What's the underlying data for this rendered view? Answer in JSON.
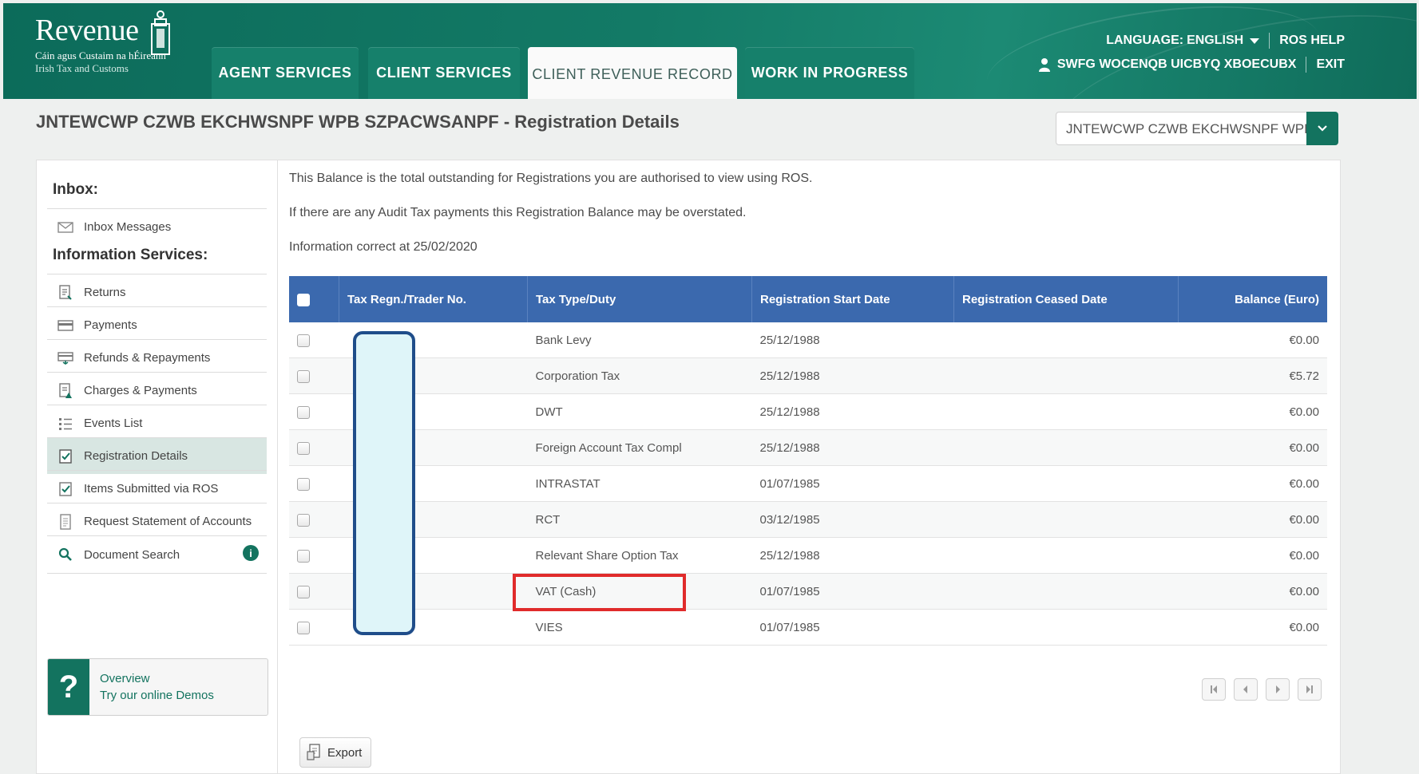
{
  "brand": {
    "name": "Revenue",
    "subtitle_irish": "Cáin agus Custaim na hÉireann",
    "subtitle_english": "Irish Tax and Customs"
  },
  "nav": {
    "tabs": [
      {
        "label": "AGENT SERVICES",
        "active": false
      },
      {
        "label": "CLIENT SERVICES",
        "active": false
      },
      {
        "label": "CLIENT REVENUE RECORD",
        "active": true
      },
      {
        "label": "WORK IN PROGRESS",
        "active": false
      }
    ]
  },
  "topbar": {
    "language_label": "LANGUAGE:",
    "language_value": "ENGLISH",
    "help": "ROS HELP",
    "user": "SWFG WOCENQB UICBYQ XBOECUBX",
    "exit": "EXIT"
  },
  "page": {
    "title": "JNTEWCWP CZWB EKCHWSNPF WPB SZPACWSANPF - Registration Details",
    "client_select": "JNTEWCWP CZWB EKCHWSNPF WPB"
  },
  "sidebar": {
    "inbox_heading": "Inbox:",
    "inbox_items": [
      {
        "label": "Inbox Messages",
        "icon": "envelope-icon"
      }
    ],
    "info_heading": "Information Services:",
    "items": [
      {
        "label": "Returns",
        "icon": "returns-icon",
        "active": false
      },
      {
        "label": "Payments",
        "icon": "card-icon",
        "active": false
      },
      {
        "label": "Refunds & Repayments",
        "icon": "refund-icon",
        "active": false
      },
      {
        "label": "Charges & Payments",
        "icon": "charges-icon",
        "active": false
      },
      {
        "label": "Events List",
        "icon": "list-icon",
        "active": false
      },
      {
        "label": "Registration Details",
        "icon": "checkbox-doc-icon",
        "active": true
      },
      {
        "label": "Items Submitted via ROS",
        "icon": "checkbox-doc-icon",
        "active": false
      },
      {
        "label": "Request Statement of Accounts",
        "icon": "document-icon",
        "active": false
      },
      {
        "label": "Document Search",
        "icon": "search-icon",
        "active": false
      }
    ],
    "demos": {
      "title": "Overview",
      "subtitle": "Try our online Demos"
    }
  },
  "notes": {
    "line1": "This Balance is the total outstanding for Registrations you are authorised to view using ROS.",
    "line2": "If there are any Audit Tax payments this Registration Balance may be overstated.",
    "line3": "Information correct at 25/02/2020"
  },
  "table": {
    "headers": [
      "Tax Regn./Trader No.",
      "Tax Type/Duty",
      "Registration Start Date",
      "Registration Ceased Date",
      "Balance (Euro)"
    ],
    "rows": [
      {
        "tax_type": "Bank Levy",
        "start": "25/12/1988",
        "ceased": "",
        "balance": "€0.00"
      },
      {
        "tax_type": "Corporation Tax",
        "start": "25/12/1988",
        "ceased": "",
        "balance": "€5.72"
      },
      {
        "tax_type": "DWT",
        "start": "25/12/1988",
        "ceased": "",
        "balance": "€0.00"
      },
      {
        "tax_type": "Foreign Account Tax Compl",
        "start": "25/12/1988",
        "ceased": "",
        "balance": "€0.00"
      },
      {
        "tax_type": "INTRASTAT",
        "start": "01/07/1985",
        "ceased": "",
        "balance": "€0.00"
      },
      {
        "tax_type": "RCT",
        "start": "03/12/1985",
        "ceased": "",
        "balance": "€0.00"
      },
      {
        "tax_type": "Relevant Share Option Tax",
        "start": "25/12/1988",
        "ceased": "",
        "balance": "€0.00"
      },
      {
        "tax_type": "VAT (Cash)",
        "start": "01/07/1985",
        "ceased": "",
        "balance": "€0.00"
      },
      {
        "tax_type": "VIES",
        "start": "01/07/1985",
        "ceased": "",
        "balance": "€0.00"
      }
    ]
  },
  "actions": {
    "export": "Export"
  },
  "colors": {
    "brand_green": "#13735f",
    "table_header_blue": "#3b69ae",
    "highlight_red": "#e02b2b"
  }
}
